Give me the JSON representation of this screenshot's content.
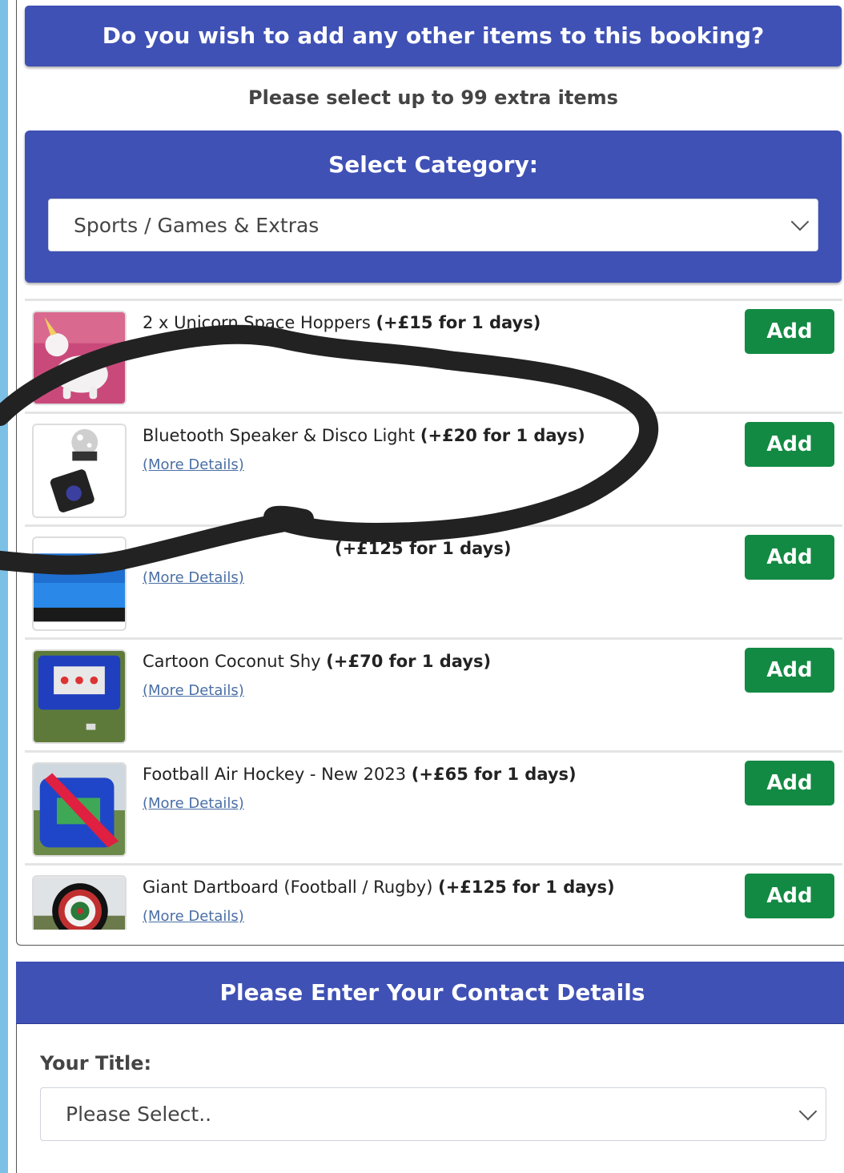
{
  "header": {
    "question": "Do you wish to add any other items to this booking?"
  },
  "subtext": "Please select up to 99 extra items",
  "category": {
    "title": "Select Category:",
    "selected": "Sports / Games & Extras"
  },
  "items": [
    {
      "name": "2 x Unicorn Space Hoppers",
      "price": "(+£15 for 1 days)",
      "more": "",
      "add": "Add",
      "thumb": "unicorn-hopper-image"
    },
    {
      "name": "Bluetooth Speaker & Disco Light",
      "price": "(+£20 for 1 days)",
      "more": "(More Details)",
      "add": "Add",
      "thumb": "speaker-disco-image"
    },
    {
      "name": "",
      "price": "(+£125 for 1 days)",
      "more": "(More Details)",
      "add": "Add",
      "thumb": "inflatable-image"
    },
    {
      "name": "Cartoon Coconut Shy",
      "price": "(+£70 for 1 days)",
      "more": "(More Details)",
      "add": "Add",
      "thumb": "coconut-shy-image"
    },
    {
      "name": "Football Air Hockey - New 2023",
      "price": "(+£65 for 1 days)",
      "more": "(More Details)",
      "add": "Add",
      "thumb": "air-hockey-image"
    },
    {
      "name": "Giant Dartboard (Football / Rugby)",
      "price": "(+£125 for 1 days)",
      "more": "(More Details)",
      "add": "Add",
      "thumb": "dartboard-image"
    }
  ],
  "contact": {
    "title": "Please Enter Your Contact Details",
    "your_title_label": "Your Title:",
    "your_title_placeholder": "Please Select.."
  },
  "colors": {
    "primary": "#3f51b5",
    "add_button": "#138a43",
    "link": "#4a6fa5",
    "scribble": "#222222"
  }
}
